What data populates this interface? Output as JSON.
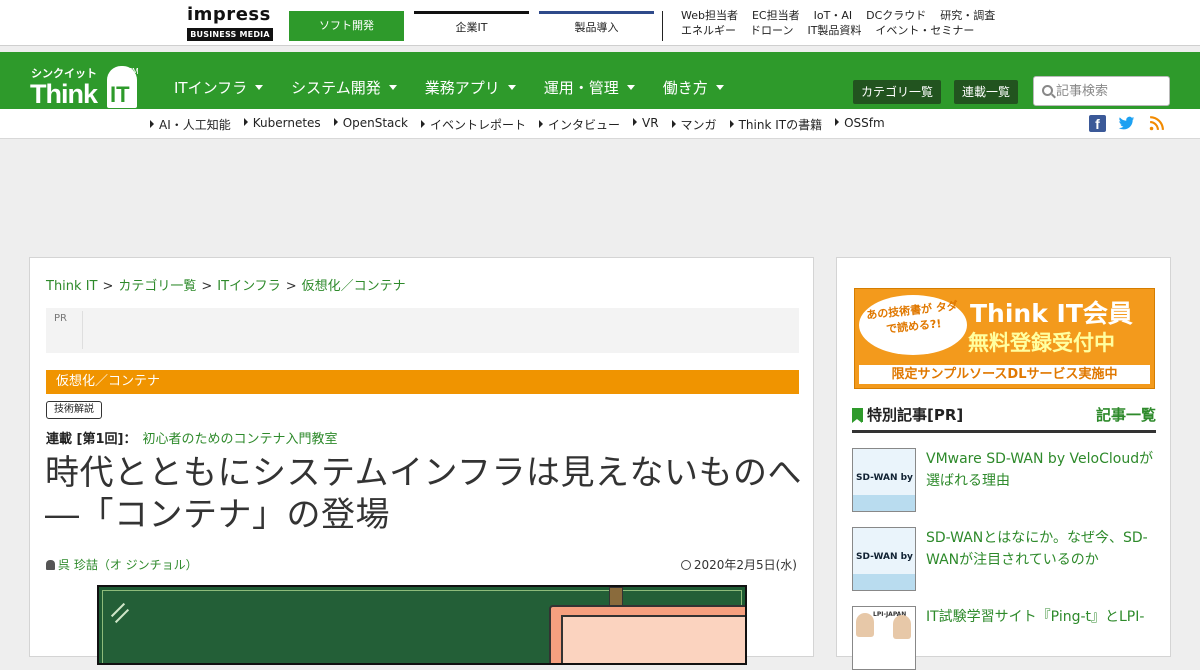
{
  "topbar": {
    "brand_word": "impress",
    "brand_sub": "BUSINESS MEDIA",
    "tabs": [
      "ソフト開発",
      "企業IT",
      "製品導入"
    ],
    "links_row1": [
      "Web担当者",
      "EC担当者",
      "IoT・AI",
      "DCクラウド",
      "研究・調査"
    ],
    "links_row2": [
      "エネルギー",
      "ドローン",
      "IT製品資料",
      "イベント・セミナー"
    ]
  },
  "nav": {
    "logo_kana": "シンクイット",
    "logo_think": "Think",
    "logo_it": "IT",
    "logo_tm": "TM",
    "menu": [
      "ITインフラ",
      "システム開発",
      "業務アプリ",
      "運用・管理",
      "働き方"
    ],
    "category_button": "カテゴリ一覧",
    "series_button": "連載一覧",
    "search_placeholder": "記事検索"
  },
  "tags": [
    "AI・人工知能",
    "Kubernetes",
    "OpenStack",
    "イベントレポート",
    "インタビュー",
    "VR",
    "マンガ",
    "Think ITの書籍",
    "OSSfm"
  ],
  "article": {
    "breadcrumb": [
      "Think IT",
      "カテゴリ一覧",
      "ITインフラ",
      "仮想化／コンテナ"
    ],
    "breadcrumb_sep": ">",
    "pr_label": "PR",
    "category": "仮想化／コンテナ",
    "badge": "技術解説",
    "series_label": "連載 [第1回]：",
    "series_name": "初心者のためのコンテナ入門教室",
    "title": "時代とともにシステムインフラは見えないものへ―「コンテナ」の登場",
    "author": "呉 珍喆（オ ジンチョル）",
    "date": "2020年2月5日(水)"
  },
  "sidebar": {
    "banner_bubble": "あの技術書が タダで読める?!",
    "banner_big1": "Think IT会員",
    "banner_big2": "無料登録受付中",
    "banner_strip": "限定サンプルソースDLサービス実施中",
    "section_title": "特別記事[PR]",
    "section_more": "記事一覧",
    "items": [
      {
        "thumb": "SD-WAN by Ve 導入ガイド",
        "text": "VMware SD-WAN by VeloCloudが選ばれる理由"
      },
      {
        "thumb": "SD-WAN by Ve 導入ガイド",
        "text": "SD-WANとはなにか。なぜ今、SD-WANが注目されているのか"
      },
      {
        "thumb": "LPI-JAPAN",
        "text": "IT試験学習サイト『Ping-t』とLPI-"
      }
    ]
  },
  "colors": {
    "brand_green": "#2e9a2b",
    "link_green": "#2e8a2b",
    "category_orange": "#f09400",
    "dark_button": "#22541f"
  }
}
